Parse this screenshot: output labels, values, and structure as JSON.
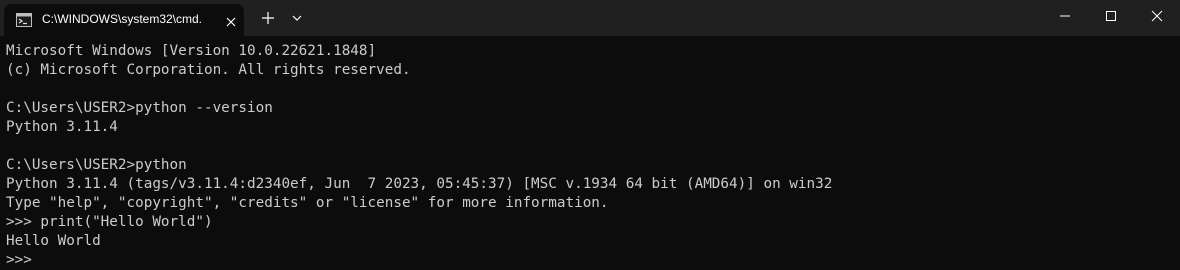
{
  "titlebar": {
    "tab_title": "C:\\WINDOWS\\system32\\cmd.",
    "tab_icon": "cmd-terminal-icon",
    "close_icon": "close-icon",
    "new_tab_icon": "plus-icon",
    "dropdown_icon": "chevron-down-icon",
    "minimize_icon": "minimize-icon",
    "maximize_icon": "maximize-icon",
    "window_close_icon": "close-icon"
  },
  "terminal": {
    "lines": [
      "Microsoft Windows [Version 10.0.22621.1848]",
      "(c) Microsoft Corporation. All rights reserved.",
      "",
      "C:\\Users\\USER2>python --version",
      "Python 3.11.4",
      "",
      "C:\\Users\\USER2>python",
      "Python 3.11.4 (tags/v3.11.4:d2340ef, Jun  7 2023, 05:45:37) [MSC v.1934 64 bit (AMD64)] on win32",
      "Type \"help\", \"copyright\", \"credits\" or \"license\" for more information.",
      ">>> print(\"Hello World\")",
      "Hello World",
      ">>> "
    ]
  },
  "colors": {
    "background": "#0c0c0c",
    "titlebar": "#202020",
    "text": "#cccccc",
    "title_text": "#ffffff"
  }
}
